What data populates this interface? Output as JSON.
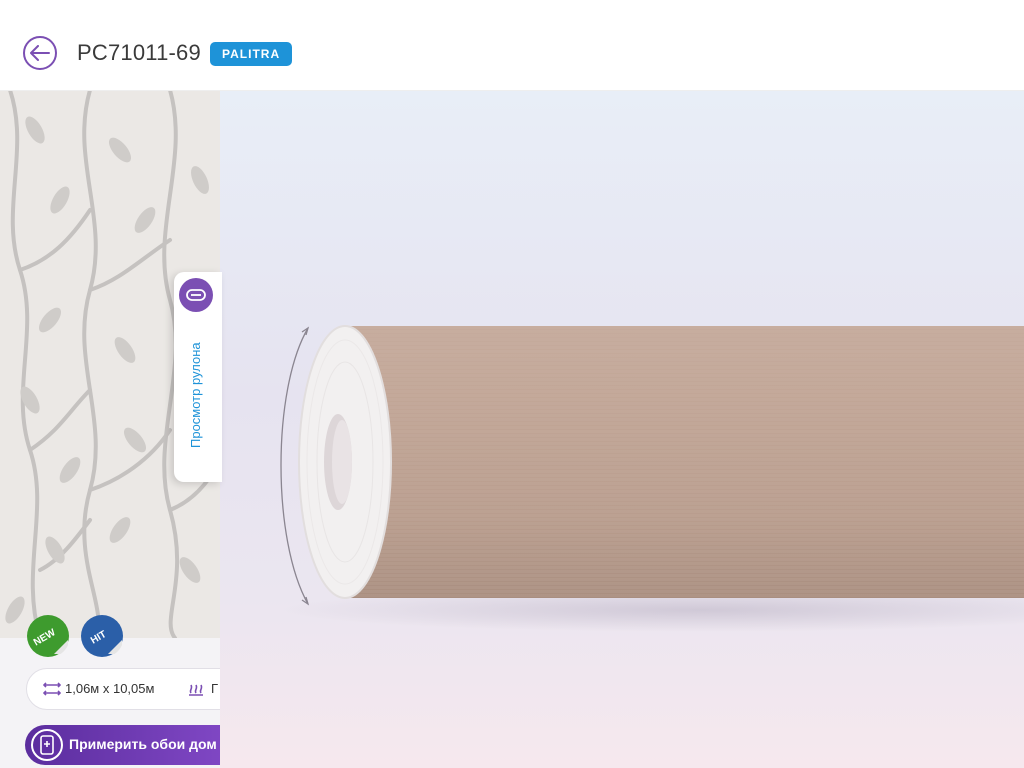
{
  "header": {
    "title": "PC71011-69",
    "brand_badge": "PALITRA"
  },
  "icons": {
    "back": "arrow-left-icon",
    "roll_view": "roll-icon",
    "size": "width-arrows-icon",
    "type": "heating-icon",
    "try": "phone-plus-icon"
  },
  "badges": {
    "new": "NEW",
    "hit": "HIT"
  },
  "side_tab": {
    "label": "Просмотр рулона"
  },
  "specs": {
    "size": "1,06м x 10,05м",
    "type_partial": "Г"
  },
  "actions": {
    "try_label": "Примерить обои дом"
  },
  "colors": {
    "accent_purple": "#7b4fb3",
    "brand_blue": "#1e93d8",
    "badge_new_green": "#3e9b2e",
    "badge_hit_blue": "#2b5fa8",
    "roll_color": "#bfa394"
  }
}
